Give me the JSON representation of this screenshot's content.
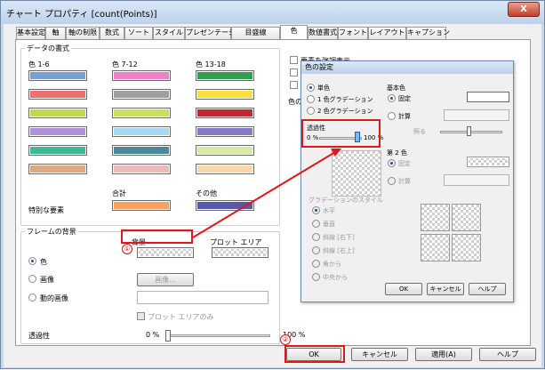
{
  "window": {
    "title": "チャート プロパティ [count(Points)]",
    "close_label": "X"
  },
  "tabs": [
    "基本設定",
    "軸",
    "軸の制限",
    "数式",
    "ソート",
    "スタイル",
    "プレゼンテーション",
    "目盛線",
    "色",
    "数値書式",
    "フォント",
    "レイアウト",
    "キャプション"
  ],
  "data_format": {
    "heading": "データの書式",
    "col1": "色 1-6",
    "col2": "色 7-12",
    "col3": "色 13-18",
    "total_label": "合計",
    "other_label": "その他",
    "special_label": "特別な要素"
  },
  "colors": {
    "col1": [
      "#7a9fd0",
      "#f07070",
      "#c0d850",
      "#b090d8",
      "#40b898",
      "#e0a880"
    ],
    "col2": [
      "#ef80c8",
      "#a0a0a0",
      "#c8e060",
      "#a8d8f0",
      "#4a8a98",
      "#f0b8b8"
    ],
    "col3": [
      "#30a050",
      "#f8e040",
      "#c02830",
      "#8878c8",
      "#d8e8a8",
      "#f8d8a8"
    ],
    "total": "#f8a060",
    "other": "#5858a8"
  },
  "frame": {
    "heading": "フレームの背景",
    "bg_label": "背景",
    "plot_label": "プロット エリア",
    "opt_color": "色",
    "opt_image": "画像",
    "opt_dynamic": "動的画像",
    "image_button": "画像...",
    "plot_only": "プロット エリアのみ",
    "transparency_label": "透過性",
    "min": "0 %",
    "max": "100 %",
    "transparency_value": 0
  },
  "right_partial": [
    "要素を強調表示",
    "色の"
  ],
  "buttons": {
    "ok": "OK",
    "cancel": "キャンセル",
    "apply": "適用(A)",
    "help": "ヘルプ"
  },
  "color_dialog": {
    "title": "色の設定",
    "opt_single": "単色",
    "opt_grad1": "1 色グラデーション",
    "opt_grad2": "2 色グラデーション",
    "base_color": "基本色",
    "fixed": "固定",
    "calc": "計算",
    "brightness": "照る",
    "transparency_label": "透過性",
    "min": "0 %",
    "max": "100 %",
    "transparency_value": 100,
    "second_color": "第 2 色",
    "fixed2": "固定",
    "calc2": "計算",
    "grad_style": "グラデーションのスタイル",
    "styles": [
      "水平",
      "垂直",
      "斜線 [右下]",
      "斜線 [右上]",
      "角から",
      "中央から"
    ],
    "ok": "OK",
    "cancel": "キャンセル",
    "help": "ヘルプ"
  },
  "markers": [
    "①",
    "②"
  ],
  "accent": "#e11818"
}
